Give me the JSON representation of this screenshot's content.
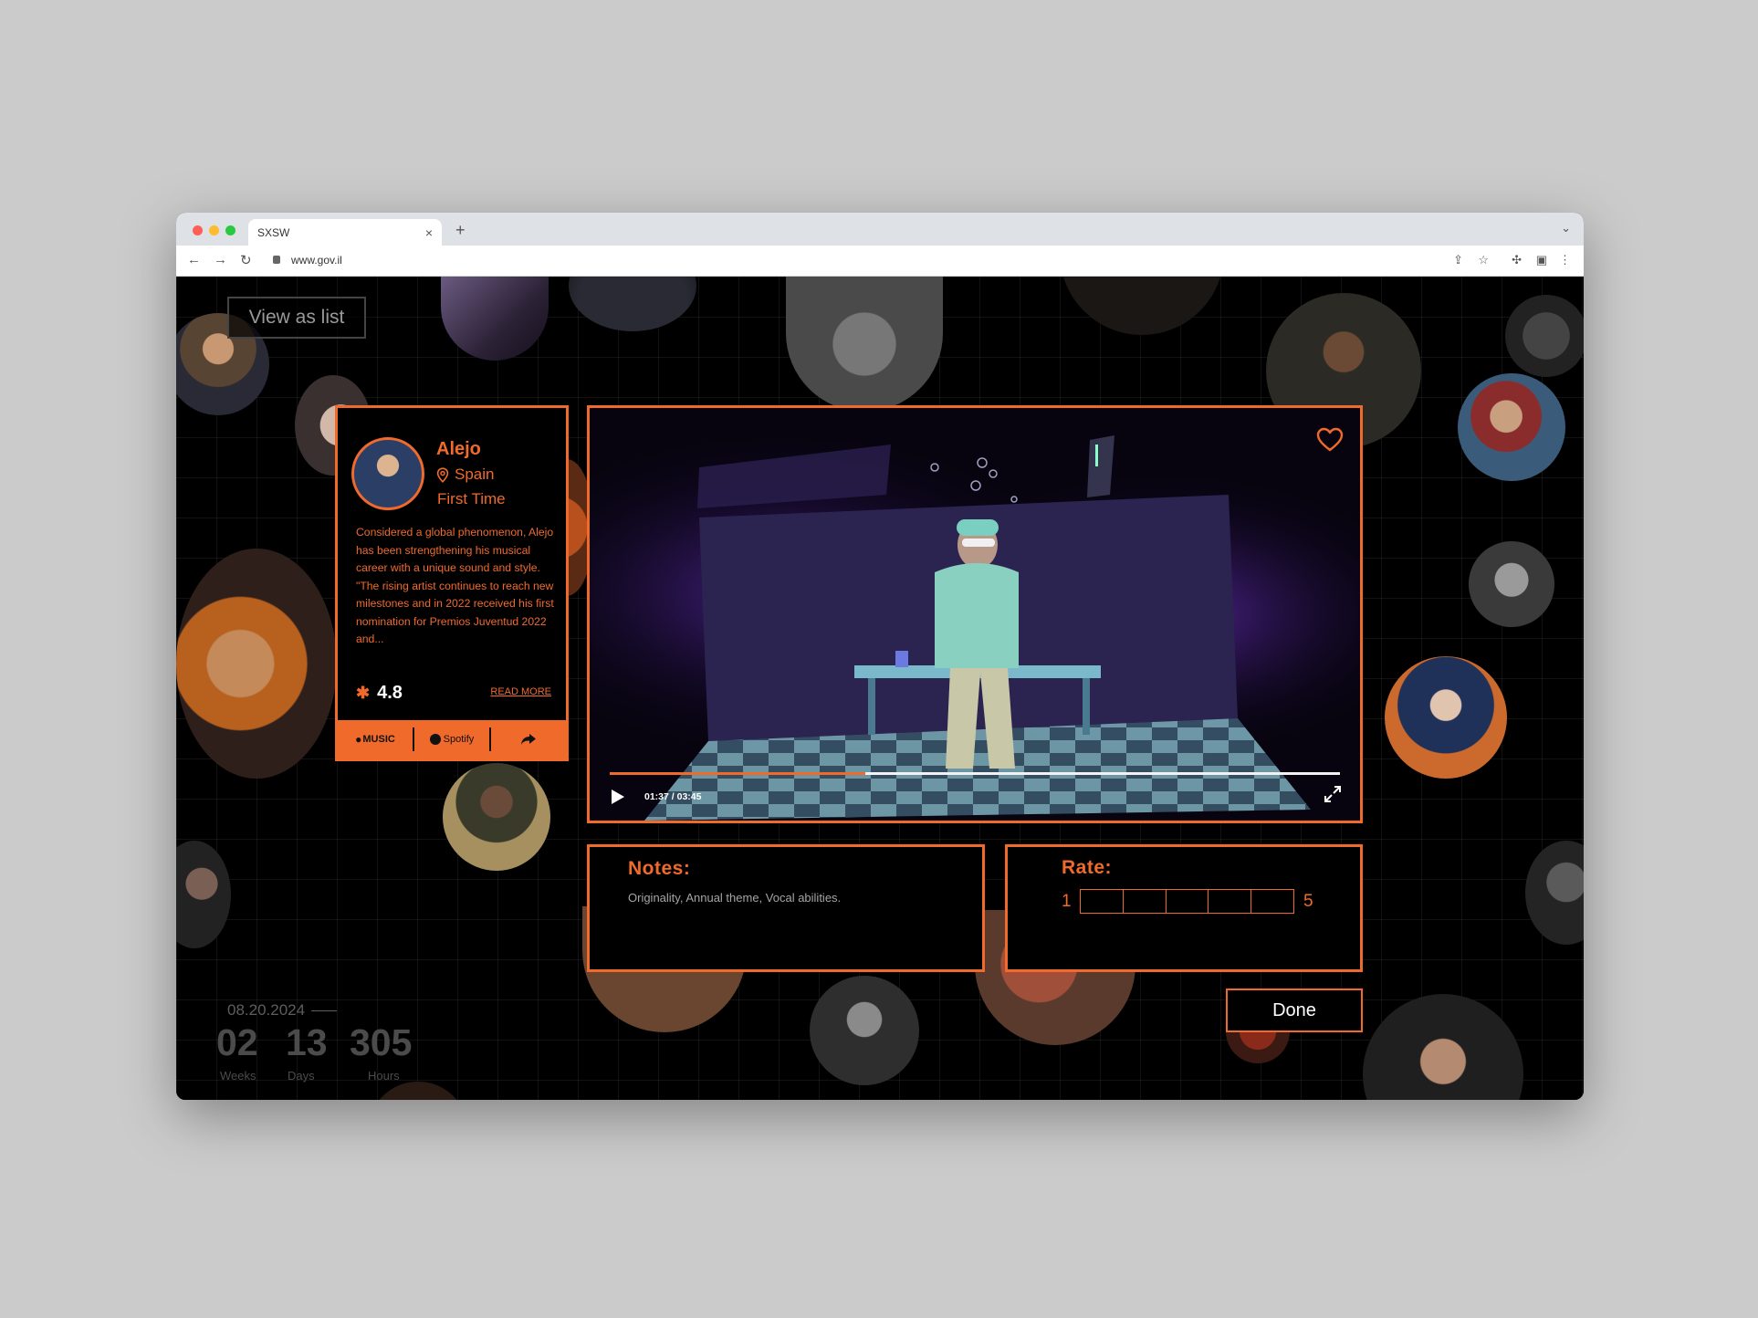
{
  "browser": {
    "tab_title": "SXSW",
    "tab_close": "×",
    "new_tab": "+",
    "url": "www.gov.il"
  },
  "page": {
    "view_list_label": "View as list"
  },
  "artist": {
    "name": "Alejo",
    "country": "Spain",
    "status": "First Time",
    "bio": "Considered a global phenomenon, Alejo has been strengthening his musical career with a unique sound and style. \"The rising artist continues to reach new milestones and in 2022 received his first nomination for Premios Juventud 2022 and...",
    "rating": "4.8",
    "read_more": "READ MORE",
    "links": [
      "MUSIC",
      "Spotify"
    ]
  },
  "video": {
    "time": "01:37 / 03:45",
    "progress": 0.35
  },
  "notes": {
    "title": "Notes:",
    "text": "Originality, Annual theme, Vocal abilities."
  },
  "rate": {
    "title": "Rate:",
    "min": "1",
    "max": "5",
    "steps": 5
  },
  "done_label": "Done",
  "countdown": {
    "date": "08.20.2024",
    "weeks": "02",
    "weeks_label": "Weeks",
    "days": "13",
    "days_label": "Days",
    "hours": "305",
    "hours_label": "Hours"
  },
  "colors": {
    "accent": "#f06a2c",
    "background": "#000000"
  }
}
